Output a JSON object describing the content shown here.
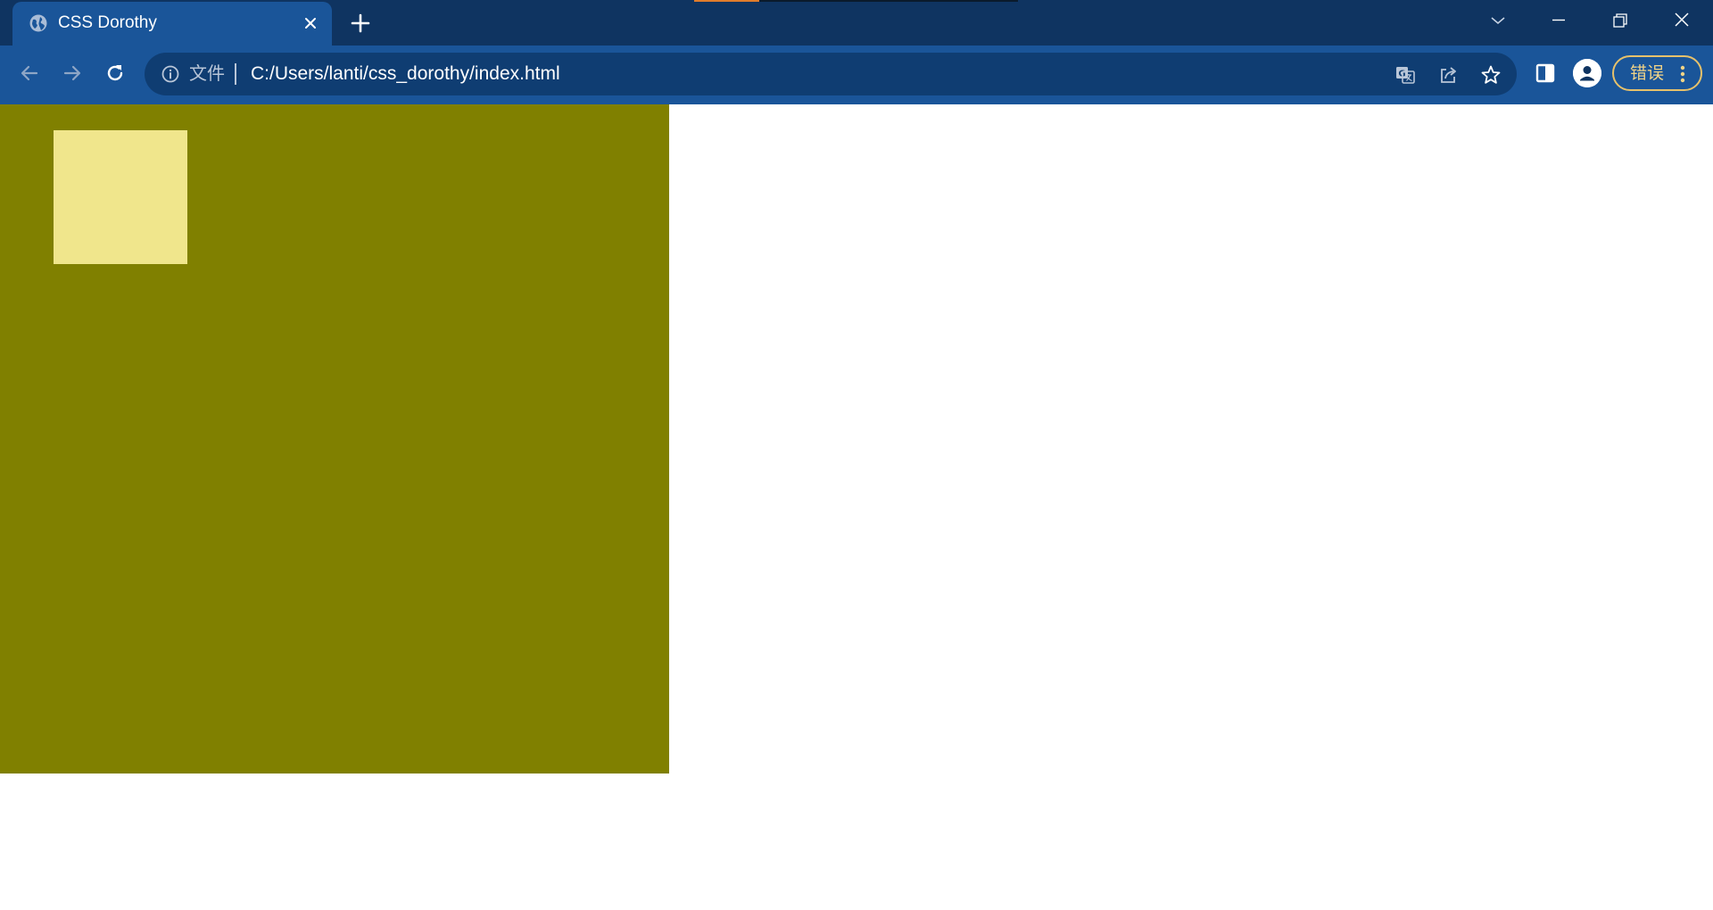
{
  "window": {
    "tab": {
      "title": "CSS Dorothy",
      "favicon": "globe-icon",
      "close_icon": "close-icon"
    },
    "new_tab_icon": "plus-icon",
    "controls": [
      "chevron-down-icon",
      "minimize-icon",
      "restore-icon",
      "close-icon"
    ]
  },
  "toolbar": {
    "back_icon": "arrow-left-icon",
    "forward_icon": "arrow-right-icon",
    "reload_icon": "reload-icon",
    "address": {
      "security_icon": "info-icon",
      "scheme_label": "文件",
      "url": "C:/Users/lanti/css_dorothy/index.html",
      "actions": [
        "translate-icon",
        "share-icon",
        "star-icon"
      ]
    },
    "side_panel_icon": "side-panel-icon",
    "profile_icon": "avatar-icon",
    "error_chip": {
      "label": "错误",
      "menu_icon": "kebab-menu-icon"
    }
  },
  "colors": {
    "tabstrip": "#0f3461",
    "toolbar": "#1a5599",
    "omnibox": "#0f3d72",
    "error_accent": "#e6c16b",
    "page_background": "#ffffff",
    "outer_box": "#808000",
    "inner_box": "#f0e68c"
  },
  "page": {
    "elements": [
      {
        "name": "outer-box",
        "color": "olive"
      },
      {
        "name": "inner-box",
        "color": "khaki"
      }
    ]
  }
}
